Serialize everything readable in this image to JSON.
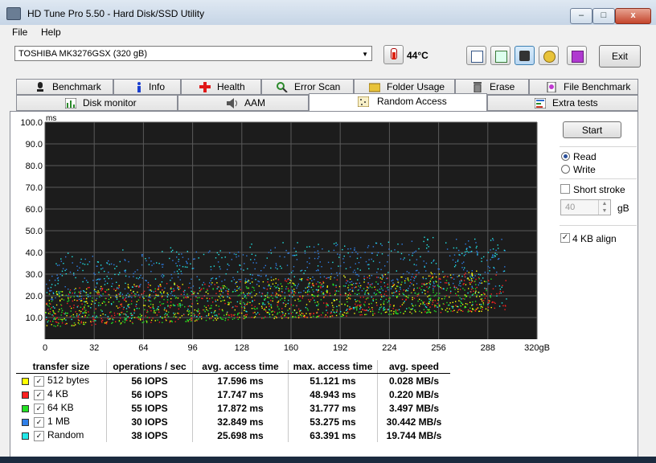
{
  "window": {
    "title": "HD Tune Pro 5.50 - Hard Disk/SSD Utility",
    "buttons": {
      "minimize": "–",
      "maximize": "□",
      "close": "x"
    }
  },
  "menu": {
    "file": "File",
    "help": "Help"
  },
  "toolbar": {
    "drive": "TOSHIBA MK3276GSX (320 gB)",
    "temperature": "44°C",
    "exit_label": "Exit",
    "icons": [
      "copy-text-icon",
      "copy-screenshot-icon",
      "camera-icon",
      "options-icon",
      "save-icon"
    ]
  },
  "tabs_row1": [
    {
      "label": "Benchmark",
      "icon": "benchmark-icon"
    },
    {
      "label": "Info",
      "icon": "info-icon"
    },
    {
      "label": "Health",
      "icon": "health-icon"
    },
    {
      "label": "Error Scan",
      "icon": "error-scan-icon"
    },
    {
      "label": "Folder Usage",
      "icon": "folder-icon"
    },
    {
      "label": "Erase",
      "icon": "erase-icon"
    },
    {
      "label": "File Benchmark",
      "icon": "file-benchmark-icon"
    }
  ],
  "tabs_row2": [
    {
      "label": "Disk monitor",
      "icon": "disk-monitor-icon"
    },
    {
      "label": "AAM",
      "icon": "speaker-icon"
    },
    {
      "label": "Random Access",
      "icon": "random-access-icon",
      "active": true
    },
    {
      "label": "Extra tests",
      "icon": "extra-tests-icon"
    }
  ],
  "panel": {
    "start_label": "Start",
    "read_label": "Read",
    "write_label": "Write",
    "mode": "read",
    "short_stroke_label": "Short stroke",
    "short_stroke_checked": false,
    "short_stroke_value": "40",
    "short_stroke_unit": "gB",
    "align_label": "4 KB align",
    "align_checked": true
  },
  "results": {
    "headers": [
      "transfer size",
      "operations / sec",
      "avg. access time",
      "max. access time",
      "avg. speed"
    ],
    "rows": [
      {
        "name": "512 bytes",
        "color": "#ffff00",
        "ops": "56 IOPS",
        "avg": "17.596 ms",
        "max": "51.121 ms",
        "speed": "0.028 MB/s"
      },
      {
        "name": "4 KB",
        "color": "#ff2020",
        "ops": "56 IOPS",
        "avg": "17.747 ms",
        "max": "48.943 ms",
        "speed": "0.220 MB/s"
      },
      {
        "name": "64 KB",
        "color": "#22e022",
        "ops": "55 IOPS",
        "avg": "17.872 ms",
        "max": "31.777 ms",
        "speed": "3.497 MB/s"
      },
      {
        "name": "1 MB",
        "color": "#2f7fe8",
        "ops": "30 IOPS",
        "avg": "32.849 ms",
        "max": "53.275 ms",
        "speed": "30.442 MB/s"
      },
      {
        "name": "Random",
        "color": "#22e8e8",
        "ops": "38 IOPS",
        "avg": "25.698 ms",
        "max": "63.391 ms",
        "speed": "19.744 MB/s"
      }
    ]
  },
  "chart_data": {
    "type": "scatter",
    "ylabel": "ms",
    "ylim": [
      0,
      100
    ],
    "yticks": [
      "100.0",
      "90.0",
      "80.0",
      "70.0",
      "60.0",
      "50.0",
      "40.0",
      "30.0",
      "20.0",
      "10.0"
    ],
    "xlim": [
      0,
      320
    ],
    "xticks": [
      "0",
      "32",
      "64",
      "96",
      "128",
      "160",
      "192",
      "224",
      "256",
      "288",
      "320gB"
    ],
    "grid": true,
    "background": "#1c1c1c",
    "series": [
      {
        "name": "512 bytes",
        "color": "#ffff00",
        "x_range": [
          0,
          290
        ],
        "y_min": [
          6,
          14
        ],
        "y_max": [
          24,
          33
        ]
      },
      {
        "name": "4 KB",
        "color": "#ff2020",
        "x_range": [
          0,
          300
        ],
        "y_min": [
          6,
          14
        ],
        "y_max": [
          24,
          32
        ]
      },
      {
        "name": "64 KB",
        "color": "#22e022",
        "x_range": [
          0,
          290
        ],
        "y_min": [
          6,
          14
        ],
        "y_max": [
          22,
          30
        ]
      },
      {
        "name": "1 MB",
        "color": "#2f7fe8",
        "x_range": [
          0,
          300
        ],
        "y_min": [
          18,
          25
        ],
        "y_max": [
          38,
          48
        ]
      },
      {
        "name": "Random",
        "color": "#22e8e8",
        "x_range": [
          0,
          300
        ],
        "y_min": [
          8,
          16
        ],
        "y_max": [
          40,
          50
        ]
      }
    ]
  }
}
